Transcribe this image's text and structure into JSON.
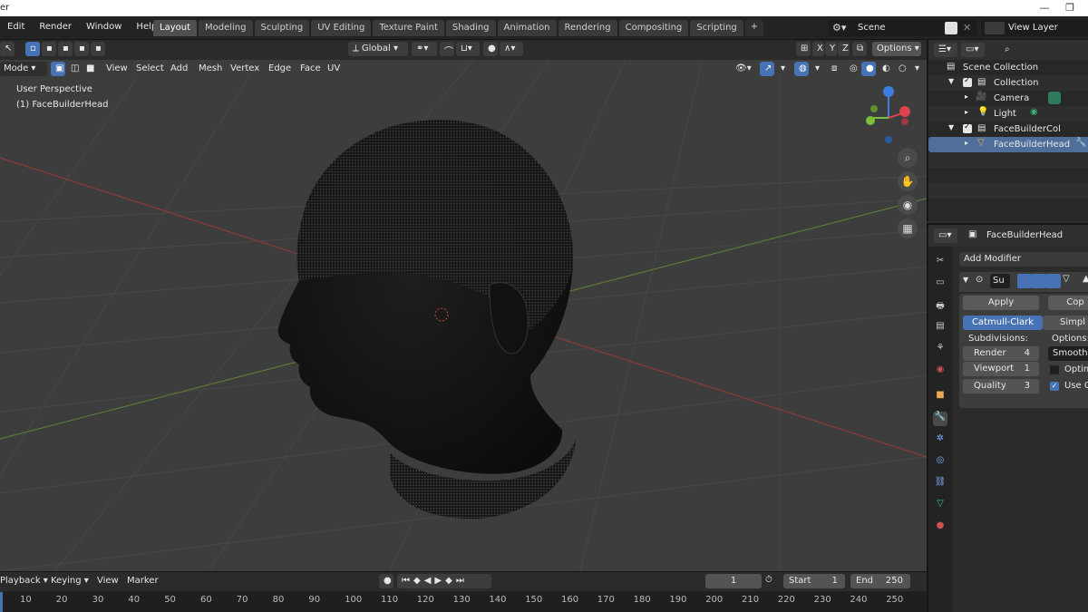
{
  "titlebar": {
    "app": "er"
  },
  "menu": [
    "Edit",
    "Render",
    "Window",
    "Help"
  ],
  "workspaces": [
    "Layout",
    "Modeling",
    "Sculpting",
    "UV Editing",
    "Texture Paint",
    "Shading",
    "Animation",
    "Rendering",
    "Compositing",
    "Scripting"
  ],
  "active_workspace": "Layout",
  "scene": {
    "name": "Scene"
  },
  "view_layer": {
    "name": "View Layer"
  },
  "viewport": {
    "orientation": "Global",
    "options_label": "Options",
    "axes": [
      "X",
      "Y",
      "Z"
    ],
    "mode": "Mode",
    "header_menus": [
      "View",
      "Select",
      "Add",
      "Mesh",
      "Vertex",
      "Edge",
      "Face",
      "UV"
    ],
    "perspective_label": "User Perspective",
    "object_label": "(1) FaceBuilderHead"
  },
  "outliner": {
    "rows": [
      {
        "label": "Scene Collection",
        "icon": "scene-collection-icon"
      },
      {
        "label": "Collection",
        "icon": "collection-icon"
      },
      {
        "label": "Camera",
        "icon": "camera-icon"
      },
      {
        "label": "Light",
        "icon": "light-icon"
      },
      {
        "label": "FaceBuilderCol",
        "icon": "collection-icon"
      },
      {
        "label": "FaceBuilderHead",
        "icon": "mesh-icon"
      }
    ]
  },
  "properties": {
    "object_name": "FaceBuilderHead",
    "add_modifier": "Add Modifier",
    "modifier_name_abbrev": "Su",
    "apply_label": "Apply",
    "copy_label": "Cop",
    "catmull_clark": "Catmull-Clark",
    "simple": "Simpl",
    "subdivisions_label": "Subdivisions:",
    "options_label": "Options:",
    "render_label": "Render",
    "render_value": "4",
    "viewport_label": "Viewport",
    "viewport_value": "1",
    "quality_label": "Quality",
    "quality_value": "3",
    "smooth_option": "Smooth, k",
    "optimal_label": "Optima",
    "use_creases_label": "Use Cr"
  },
  "timeline": {
    "playback": "Playback",
    "keying": "Keying",
    "view": "View",
    "marker": "Marker",
    "current_frame": "1",
    "start_label": "Start",
    "start_value": "1",
    "end_label": "End",
    "end_value": "250",
    "ticks": [
      "10",
      "20",
      "30",
      "40",
      "50",
      "60",
      "70",
      "80",
      "90",
      "100",
      "110",
      "120",
      "130",
      "140",
      "150",
      "160",
      "170",
      "180",
      "190",
      "200",
      "210",
      "220",
      "230",
      "240",
      "250"
    ]
  },
  "colors": {
    "accent_blue": "#4772b3",
    "selected_row": "#4f6f9a",
    "x_axis": "#b34a4a",
    "y_axis": "#7aa64a"
  }
}
